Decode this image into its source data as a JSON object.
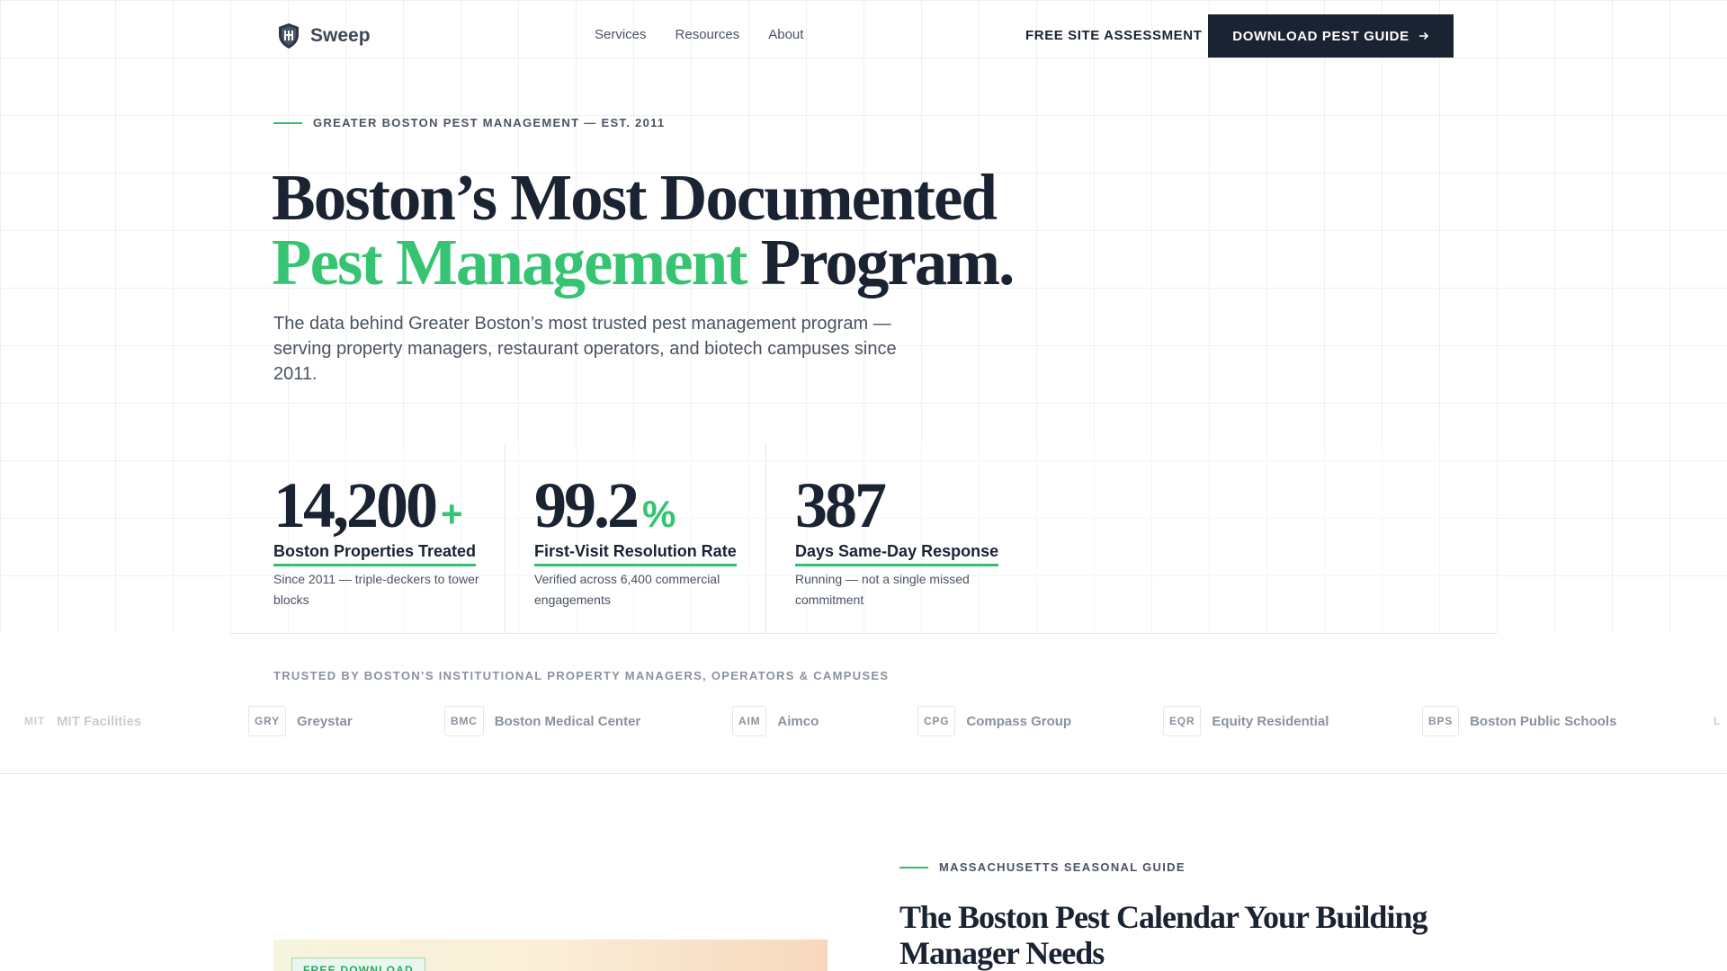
{
  "nav": {
    "brand": "Sweep",
    "links": [
      "Services",
      "Resources",
      "About"
    ],
    "secondary_cta": "FREE SITE ASSESSMENT",
    "primary_cta": "DOWNLOAD PEST GUIDE"
  },
  "hero": {
    "eyebrow": "GREATER BOSTON PEST MANAGEMENT — EST. 2011",
    "headline_line1": "Boston’s Most Documented",
    "headline_accent": "Pest Management",
    "headline_rest": " Program.",
    "subhead": "The data behind Greater Boston’s most trusted pest management program — serving property managers, restaurant operators, and biotech campuses since 2011."
  },
  "stats": [
    {
      "value": "14,200",
      "suffix": "+",
      "label": "Boston Properties Treated",
      "desc": "Since 2011 — triple-deckers to tower blocks"
    },
    {
      "value": "99.2",
      "suffix": "%",
      "label": "First-Visit Resolution Rate",
      "desc": "Verified across 6,400 commercial engagements"
    },
    {
      "value": "387",
      "suffix": "",
      "label": "Days Same-Day Response",
      "desc": "Running — not a single missed commitment"
    }
  ],
  "trusted": {
    "label": "TRUSTED BY BOSTON’S INSTITUTIONAL PROPERTY MANAGERS, OPERATORS & CAMPUSES",
    "logos": [
      {
        "abbr": "MIT",
        "name": "MIT Facilities"
      },
      {
        "abbr": "GRY",
        "name": "Greystar"
      },
      {
        "abbr": "BMC",
        "name": "Boston Medical Center"
      },
      {
        "abbr": "AIM",
        "name": "Aimco"
      },
      {
        "abbr": "CPG",
        "name": "Compass Group"
      },
      {
        "abbr": "EQR",
        "name": "Equity Residential"
      },
      {
        "abbr": "BPS",
        "name": "Boston Public Schools"
      },
      {
        "abbr": "L",
        "name": ""
      }
    ]
  },
  "guide": {
    "badge": "FREE DOWNLOAD",
    "eyebrow": "MASSACHUSETTS SEASONAL GUIDE",
    "title": "The Boston Pest Calendar Your Building Manager Needs"
  },
  "colors": {
    "accent": "#36c472",
    "ink": "#1a2332",
    "muted": "#4a5362"
  },
  "icons": {
    "brand": "shield-logo-icon",
    "cta_arrow": "arrow-right-icon"
  }
}
